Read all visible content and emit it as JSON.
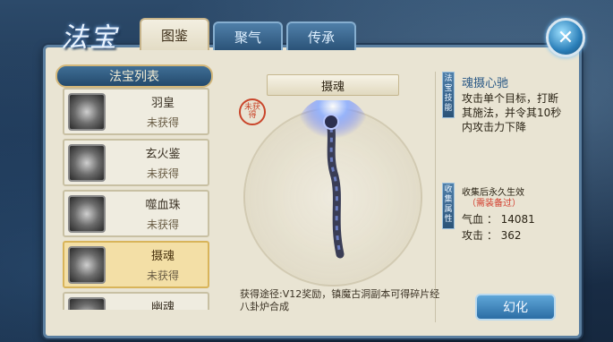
{
  "window": {
    "title": "法宝"
  },
  "tabs": [
    {
      "label": "图鉴",
      "active": true
    },
    {
      "label": "聚气",
      "active": false
    },
    {
      "label": "传承",
      "active": false
    }
  ],
  "list": {
    "header": "法宝列表",
    "items": [
      {
        "name": "羽皇",
        "status": "未获得",
        "icon": "feather-wing-icon"
      },
      {
        "name": "玄火鉴",
        "status": "未获得",
        "icon": "mirror-disc-icon"
      },
      {
        "name": "噬血珠",
        "status": "未获得",
        "icon": "swastika-orb-icon"
      },
      {
        "name": "摄魂",
        "status": "未获得",
        "icon": "staff-icon",
        "selected": true
      },
      {
        "name": "幽魂",
        "status": "",
        "icon": "ghost-icon"
      }
    ]
  },
  "detail": {
    "item_name": "摄魂",
    "seal_text": "未获得",
    "obtain_text": "获得途径:V12奖励，镇魔古洞副本可得碎片经八卦炉合成"
  },
  "skill": {
    "tag": "法宝技能",
    "title": "魂摄心驰",
    "desc": "攻击单个目标，打断其施法，并令其10秒内攻击力下降"
  },
  "collect": {
    "tag": "收集属性",
    "title": "收集后永久生效",
    "note": "（需装备过）",
    "stats": [
      {
        "label": "气血 ： 14081"
      },
      {
        "label": "攻击 ： 362"
      }
    ]
  },
  "buttons": {
    "transform": "幻化"
  },
  "colors": {
    "accent": "#2b6da4",
    "panel": "#e9e4d3",
    "selected": "#f3dfa6",
    "warning": "#d23a2a"
  }
}
